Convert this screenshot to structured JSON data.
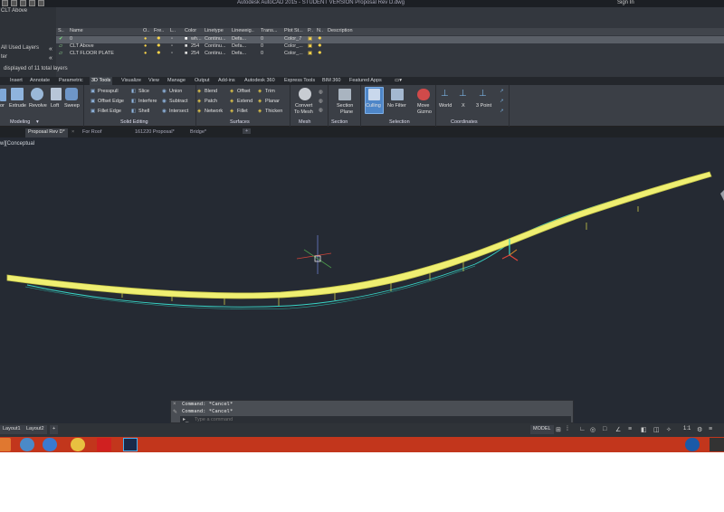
{
  "titlebar": {
    "title": "Autodesk AutoCAD 2015 - STUDENT VERSION  Proposal Rev D.dwg",
    "user": "Sign In"
  },
  "layers": {
    "current_layer": "CLT Above",
    "left_items": [
      "All Used Layers",
      "ter"
    ],
    "summary": "displayed of 11 total layers",
    "headers": [
      "S..",
      "Name",
      "O..",
      "Fre..",
      "L..",
      "Color",
      "Linetype",
      "Lineweig..",
      "Trans...",
      "Plot St...",
      "P..",
      "N..",
      "Description"
    ],
    "rows": [
      {
        "name": "0",
        "color": "wh...",
        "linetype": "Continu...",
        "lineweight": "Defa...",
        "transparency": "0",
        "plotstyle": "Color_7"
      },
      {
        "name": "CLT Above",
        "color": "254",
        "linetype": "Continu...",
        "lineweight": "Defa...",
        "transparency": "0",
        "plotstyle": "Color_..."
      },
      {
        "name": "CLT FLOOR PLATE",
        "color": "254",
        "linetype": "Continu...",
        "lineweight": "Defa...",
        "transparency": "0",
        "plotstyle": "Color_..."
      }
    ]
  },
  "ribbon_tabs": [
    "Insert",
    "Annotate",
    "Parametric",
    "3D Tools",
    "Visualize",
    "View",
    "Manage",
    "Output",
    "Add-ins",
    "Autodesk 360",
    "Express Tools",
    "BIM 360",
    "Featured Apps"
  ],
  "active_tab": "3D Tools",
  "ribbon": {
    "modeling": {
      "label": "Modeling",
      "items": [
        "Extrude",
        "Revolve",
        "Loft",
        "Sweep"
      ]
    },
    "solid_editing": {
      "label": "Solid Editing",
      "items": [
        "Presspull",
        "Offset Edge",
        "Fillet Edge",
        "Slice",
        "Interfere",
        "Shell",
        "Union",
        "Subtract",
        "Intersect"
      ]
    },
    "surfaces": {
      "label": "Surfaces",
      "items": [
        "Blend",
        "Patch",
        "Network",
        "Offset",
        "Extend",
        "Fillet",
        "Trim",
        "Planar",
        "Thicken"
      ]
    },
    "mesh": {
      "label": "Mesh",
      "items": [
        "Convert",
        "To Mesh"
      ]
    },
    "section": {
      "label": "Section",
      "items": [
        "Section",
        "Plane"
      ]
    },
    "selection": {
      "label": "Selection",
      "items": [
        "Culling",
        "No Filter",
        "Move",
        "Gizmo"
      ]
    },
    "coordinates": {
      "label": "Coordinates",
      "items": [
        "World",
        "X",
        "3 Point"
      ]
    }
  },
  "doc_tabs": [
    "Proposal Rev D*",
    "For Roof",
    "161220 Proposal*",
    "Bridge*"
  ],
  "active_doc": "Proposal Rev D*",
  "viewport": {
    "label": "w][Conceptual"
  },
  "command": {
    "history": [
      "Command: *Cancel*",
      "Command: *Cancel*"
    ],
    "placeholder": "Type a command"
  },
  "layout_tabs": [
    "Layout1",
    "Layout2"
  ],
  "status": {
    "model": "MODEL",
    "scale": "1:1"
  },
  "colors": {
    "bridge_fill": "#efef72",
    "bridge_edge": "#c8c84a",
    "cyan": "#38d6c8",
    "taskbar": "#c2361c"
  }
}
